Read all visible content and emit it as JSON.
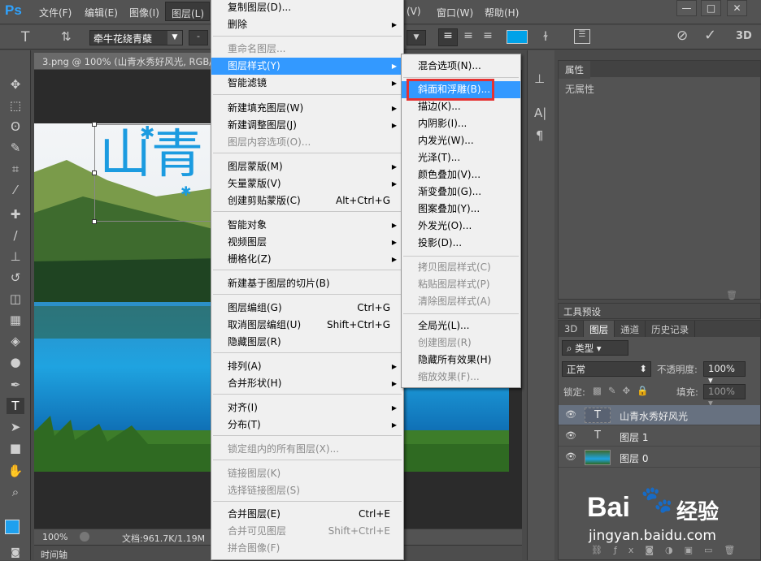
{
  "app": {
    "logo": "Ps"
  },
  "menubar": {
    "items": [
      "文件(F)",
      "编辑(E)",
      "图像(I)",
      "图层(L)"
    ],
    "right_items": [
      "(V)",
      "窗口(W)",
      "帮助(H)"
    ],
    "window_buttons": [
      "—",
      "□",
      "✕"
    ]
  },
  "options_bar": {
    "font_family": "牵牛花绕青蘖",
    "font_size_stub": "-",
    "color_swatch": "#00a2e8"
  },
  "document": {
    "tab_title": "3.png @ 100% (山青水秀好风光, RGB/",
    "canvas_text": "山青",
    "zoom": "100%",
    "doc_info": "文档:961.7K/1.19M",
    "timeline": "时间轴"
  },
  "layer_menu": {
    "items": [
      {
        "label": "复制图层(D)...",
        "disabled": false
      },
      {
        "label": "删除",
        "disabled": false,
        "submenu": true
      },
      {
        "label": "重命名图层...",
        "disabled": true
      },
      {
        "label": "图层样式(Y)",
        "disabled": false,
        "submenu": true,
        "highlight": true
      },
      {
        "label": "智能滤镜",
        "disabled": false,
        "submenu": true
      },
      {
        "label": "新建填充图层(W)",
        "disabled": false,
        "submenu": true
      },
      {
        "label": "新建调整图层(J)",
        "disabled": false,
        "submenu": true
      },
      {
        "label": "图层内容选项(O)...",
        "disabled": true
      },
      {
        "label": "图层蒙版(M)",
        "disabled": false,
        "submenu": true
      },
      {
        "label": "矢量蒙版(V)",
        "disabled": false,
        "submenu": true
      },
      {
        "label": "创建剪贴蒙版(C)",
        "disabled": false,
        "shortcut": "Alt+Ctrl+G"
      },
      {
        "label": "智能对象",
        "disabled": false,
        "submenu": true
      },
      {
        "label": "视频图层",
        "disabled": false,
        "submenu": true
      },
      {
        "label": "栅格化(Z)",
        "disabled": false,
        "submenu": true
      },
      {
        "label": "新建基于图层的切片(B)",
        "disabled": false
      },
      {
        "label": "图层编组(G)",
        "disabled": false,
        "shortcut": "Ctrl+G"
      },
      {
        "label": "取消图层编组(U)",
        "disabled": false,
        "shortcut": "Shift+Ctrl+G"
      },
      {
        "label": "隐藏图层(R)",
        "disabled": false
      },
      {
        "label": "排列(A)",
        "disabled": false,
        "submenu": true
      },
      {
        "label": "合并形状(H)",
        "disabled": false,
        "submenu": true
      },
      {
        "label": "对齐(I)",
        "disabled": false,
        "submenu": true
      },
      {
        "label": "分布(T)",
        "disabled": false,
        "submenu": true
      },
      {
        "label": "锁定组内的所有图层(X)...",
        "disabled": true
      },
      {
        "label": "链接图层(K)",
        "disabled": true
      },
      {
        "label": "选择链接图层(S)",
        "disabled": true
      },
      {
        "label": "合并图层(E)",
        "disabled": false,
        "shortcut": "Ctrl+E"
      },
      {
        "label": "合并可见图层",
        "disabled": true,
        "shortcut": "Shift+Ctrl+E"
      },
      {
        "label": "拼合图像(F)",
        "disabled": true
      }
    ]
  },
  "style_submenu": {
    "items": [
      {
        "label": "混合选项(N)...",
        "disabled": false
      },
      {
        "label": "斜面和浮雕(B)...",
        "disabled": false,
        "highlight": true
      },
      {
        "label": "描边(K)...",
        "disabled": false
      },
      {
        "label": "内阴影(I)...",
        "disabled": false
      },
      {
        "label": "内发光(W)...",
        "disabled": false
      },
      {
        "label": "光泽(T)...",
        "disabled": false
      },
      {
        "label": "颜色叠加(V)...",
        "disabled": false
      },
      {
        "label": "渐变叠加(G)...",
        "disabled": false
      },
      {
        "label": "图案叠加(Y)...",
        "disabled": false
      },
      {
        "label": "外发光(O)...",
        "disabled": false
      },
      {
        "label": "投影(D)...",
        "disabled": false
      },
      {
        "label": "拷贝图层样式(C)",
        "disabled": true
      },
      {
        "label": "粘贴图层样式(P)",
        "disabled": true
      },
      {
        "label": "清除图层样式(A)",
        "disabled": true
      },
      {
        "label": "全局光(L)...",
        "disabled": false
      },
      {
        "label": "创建图层(R)",
        "disabled": true
      },
      {
        "label": "隐藏所有效果(H)",
        "disabled": false
      },
      {
        "label": "缩放效果(F)...",
        "disabled": true
      }
    ]
  },
  "properties_panel": {
    "tab": "属性",
    "empty_text": "无属性"
  },
  "tool_presets": {
    "tab": "工具预设"
  },
  "layers_panel": {
    "tabs": [
      "3D",
      "图层",
      "通道",
      "历史记录"
    ],
    "filter": "类型",
    "blend_mode": "正常",
    "opacity_label": "不透明度:",
    "opacity": "100%",
    "lock_label": "锁定:",
    "fill_label": "填充:",
    "fill": "100%",
    "layers": [
      {
        "name": "山青水秀好风光",
        "kind": "text",
        "selected": true
      },
      {
        "name": "图层 1",
        "kind": "text",
        "selected": false
      },
      {
        "name": "图层 0",
        "kind": "image",
        "selected": false
      }
    ]
  },
  "watermark": {
    "brand": "Bai",
    "brand_cn": "经验",
    "url": "jingyan.baidu.com"
  }
}
